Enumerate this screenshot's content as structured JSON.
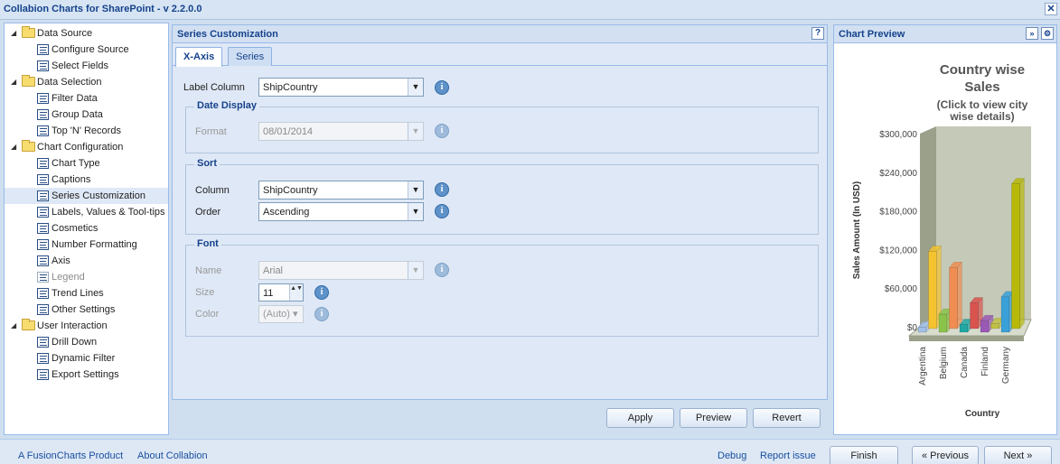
{
  "app": {
    "title": "Collabion Charts for SharePoint - v 2.2.0.0",
    "close_label": "✕"
  },
  "tree": [
    {
      "label": "Data Source",
      "children": [
        "Configure Source",
        "Select Fields"
      ]
    },
    {
      "label": "Data Selection",
      "children": [
        "Filter Data",
        "Group Data",
        "Top 'N' Records"
      ]
    },
    {
      "label": "Chart Configuration",
      "children": [
        "Chart Type",
        "Captions",
        "Series Customization",
        "Labels, Values & Tool-tips",
        "Cosmetics",
        "Number Formatting",
        "Axis",
        "Legend",
        "Trend Lines",
        "Other Settings"
      ]
    },
    {
      "label": "User Interaction",
      "children": [
        "Drill Down",
        "Dynamic Filter",
        "Export Settings"
      ]
    }
  ],
  "tree_toggle_glyph": "◢",
  "panel": {
    "title": "Series Customization",
    "help": "?",
    "tabs": [
      "X-Axis",
      "Series"
    ],
    "label_column": {
      "label": "Label Column",
      "value": "ShipCountry"
    },
    "date_display": {
      "legend": "Date Display",
      "format_label": "Format",
      "format_value": "08/01/2014"
    },
    "sort": {
      "legend": "Sort",
      "column_label": "Column",
      "column_value": "ShipCountry",
      "order_label": "Order",
      "order_value": "Ascending"
    },
    "font": {
      "legend": "Font",
      "name_label": "Name",
      "name_value": "Arial",
      "size_label": "Size",
      "size_value": "11",
      "color_label": "Color",
      "color_value": "(Auto) ▾"
    },
    "buttons": {
      "apply": "Apply",
      "preview": "Preview",
      "revert": "Revert"
    },
    "info_glyph": "i",
    "dropdown_glyph": "▼",
    "spin_glyph": "▲▼"
  },
  "preview": {
    "title": "Chart Preview",
    "expand": "»",
    "settings": "⚙"
  },
  "chart_data": {
    "type": "bar",
    "title": "Country wise Sales",
    "title_lines": [
      "Country wise",
      "Sales"
    ],
    "subtitle": "(Click to view city wise details)",
    "subtitle_lines": [
      "(Click to view city",
      "wise details)"
    ],
    "xlabel": "Country",
    "ylabel": "Sales Amount (In USD)",
    "ylim": [
      0,
      300000
    ],
    "y_ticks": [
      "$0",
      "$60,000",
      "$120,000",
      "$180,000",
      "$240,000",
      "$300,000"
    ],
    "tick_values": [
      0,
      60000,
      120000,
      180000,
      240000,
      300000
    ],
    "categories": [
      "Argentina",
      "",
      "Belgium",
      "",
      "Canada",
      "",
      "Finland",
      "",
      "Germany",
      ""
    ],
    "values": [
      8000,
      120000,
      28000,
      95000,
      12000,
      40000,
      18000,
      8000,
      55000,
      225000
    ],
    "colors": [
      "#9fbfe6",
      "#f5c330",
      "#8bc34a",
      "#f08d52",
      "#21a7a4",
      "#d9534f",
      "#9b59b6",
      "#c0c044",
      "#3aa0d8",
      "#b8b80a"
    ]
  },
  "bottom": {
    "fusion_link": "A FusionCharts Product",
    "about_link": "About Collabion",
    "debug_link": "Debug",
    "report_link": "Report issue",
    "finish": "Finish",
    "previous": "« Previous",
    "next": "Next »"
  }
}
